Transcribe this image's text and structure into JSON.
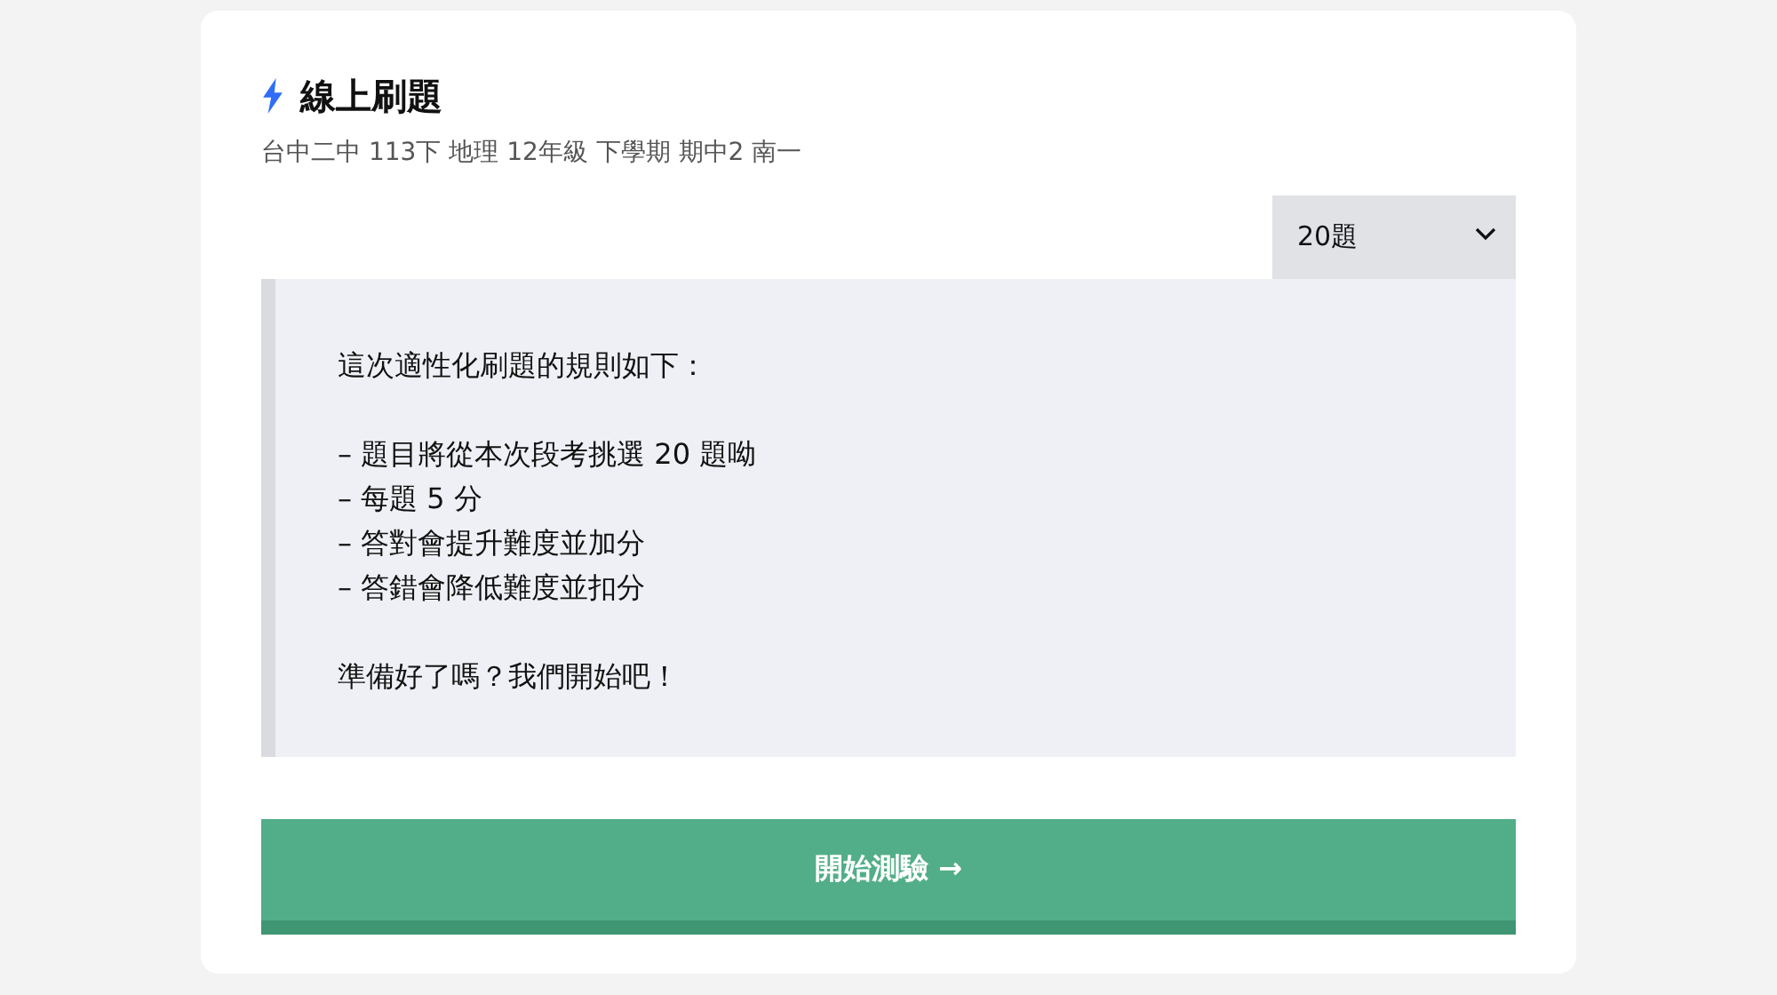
{
  "header": {
    "title": "線上刷題",
    "subtitle": "台中二中 113下 地理 12年級 下學期 期中2 南一"
  },
  "count_select": {
    "value": "20題"
  },
  "rules": {
    "intro": "這次適性化刷題的規則如下：",
    "items": [
      "– 題目將從本次段考挑選 20 題呦",
      "– 每題 5 分",
      "– 答對會提升難度並加分",
      "– 答錯會降低難度並扣分"
    ],
    "closing": "準備好了嗎？我們開始吧！"
  },
  "start_button": {
    "label": "開始測驗 →"
  }
}
